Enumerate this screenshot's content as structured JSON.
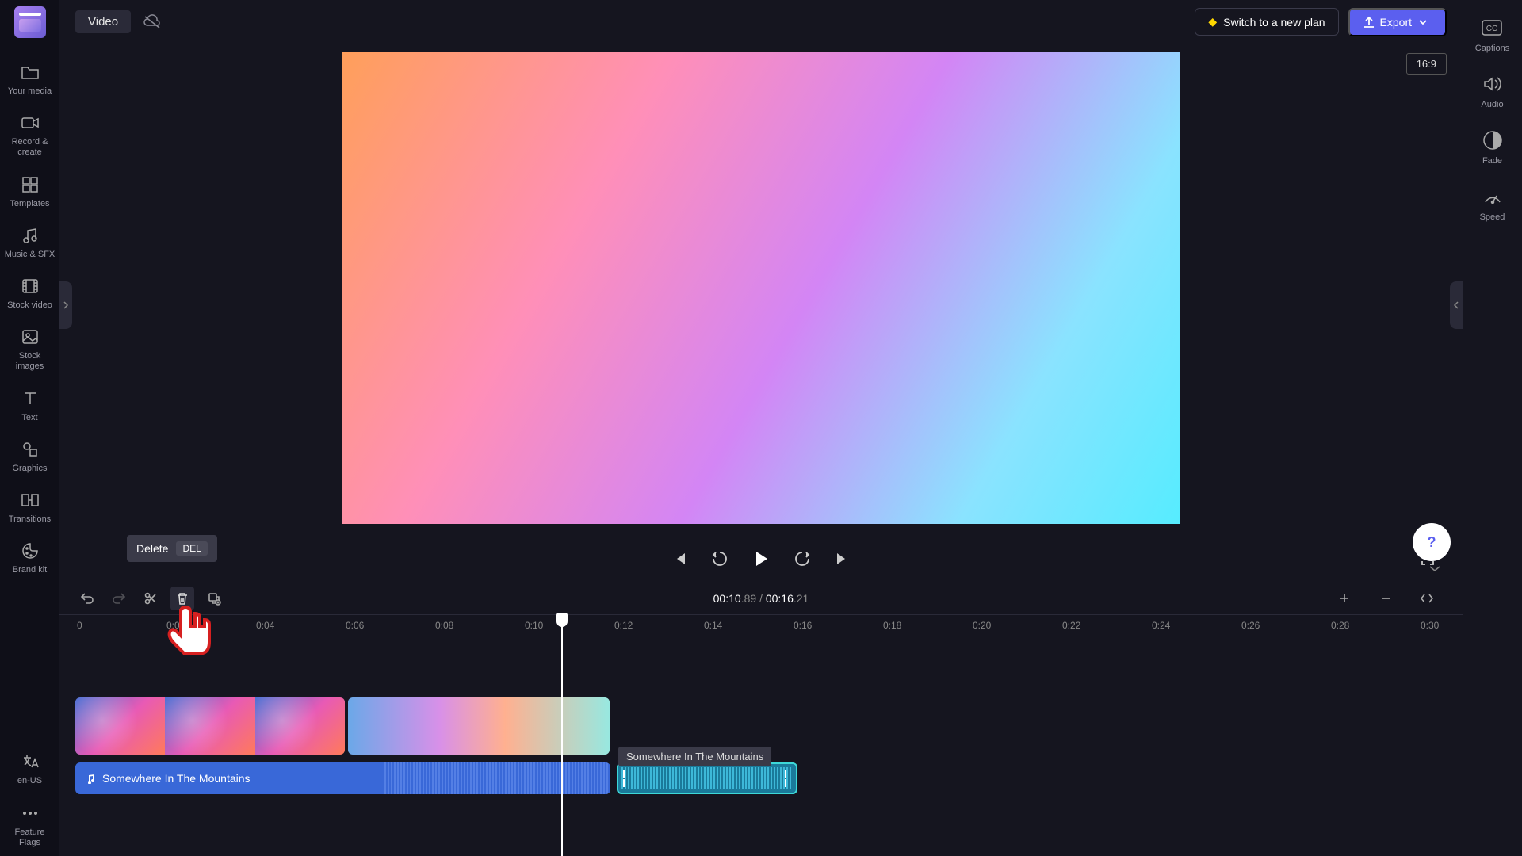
{
  "project_name": "Video",
  "top_bar": {
    "plan_button": "Switch to a new plan",
    "export_button": "Export"
  },
  "left_sidebar": [
    {
      "id": "your-media",
      "label": "Your media"
    },
    {
      "id": "record-create",
      "label": "Record & create"
    },
    {
      "id": "templates",
      "label": "Templates"
    },
    {
      "id": "music-sfx",
      "label": "Music & SFX"
    },
    {
      "id": "stock-video",
      "label": "Stock video"
    },
    {
      "id": "stock-images",
      "label": "Stock images"
    },
    {
      "id": "text",
      "label": "Text"
    },
    {
      "id": "graphics",
      "label": "Graphics"
    },
    {
      "id": "transitions",
      "label": "Transitions"
    },
    {
      "id": "brand-kit",
      "label": "Brand kit"
    }
  ],
  "left_sidebar_bottom": [
    {
      "id": "lang",
      "label": "en-US"
    },
    {
      "id": "feature-flags",
      "label": "Feature Flags"
    }
  ],
  "right_sidebar": [
    {
      "id": "captions",
      "label": "Captions"
    },
    {
      "id": "audio",
      "label": "Audio"
    },
    {
      "id": "fade",
      "label": "Fade"
    },
    {
      "id": "speed",
      "label": "Speed"
    }
  ],
  "aspect_ratio": "16:9",
  "time": {
    "current": "00:10",
    "current_frac": ".89",
    "sep": " / ",
    "total": "00:16",
    "total_frac": ".21"
  },
  "tooltip": {
    "label": "Delete",
    "key": "DEL"
  },
  "ruler_ticks": [
    "0",
    "0:02",
    "0:04",
    "0:06",
    "0:08",
    "0:10",
    "0:12",
    "0:14",
    "0:16",
    "0:18",
    "0:20",
    "0:22",
    "0:24",
    "0:26",
    "0:28",
    "0:30"
  ],
  "audio_clip1_title": "Somewhere In The Mountains",
  "audio_clip2_label": "Somewhere In The Mountains"
}
